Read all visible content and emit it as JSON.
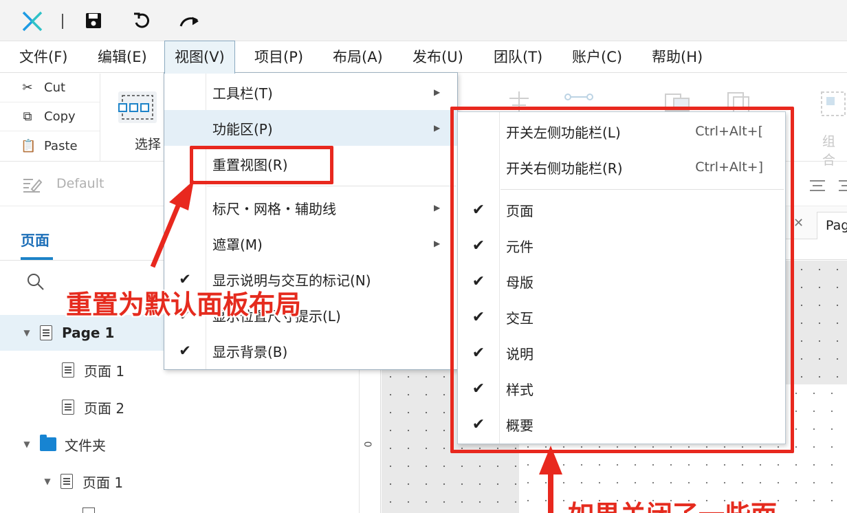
{
  "menubar": {
    "items": [
      {
        "label": "文件(F)"
      },
      {
        "label": "编辑(E)"
      },
      {
        "label": "视图(V)"
      },
      {
        "label": "项目(P)"
      },
      {
        "label": "布局(A)"
      },
      {
        "label": "发布(U)"
      },
      {
        "label": "团队(T)"
      },
      {
        "label": "账户(C)"
      },
      {
        "label": "帮助(H)"
      }
    ]
  },
  "clipboard": {
    "cut": "Cut",
    "copy": "Copy",
    "paste": "Paste"
  },
  "ribbon": {
    "select_label": "选择",
    "group_label": "组合"
  },
  "stylebar": {
    "style_name": "Default"
  },
  "pages_panel": {
    "tab_label": "页面",
    "tree": [
      {
        "label": "Page 1"
      },
      {
        "label": "页面 1"
      },
      {
        "label": "页面 2"
      },
      {
        "label": "文件夹"
      },
      {
        "label": "页面 1"
      }
    ]
  },
  "canvas": {
    "tab_label": "Pag",
    "ruler_zero": "0"
  },
  "view_menu": {
    "items": [
      {
        "label": "工具栏(T)"
      },
      {
        "label": "功能区(P)"
      },
      {
        "label": "重置视图(R)"
      },
      {
        "label": "标尺・网格・辅助线"
      },
      {
        "label": "遮罩(M)"
      },
      {
        "label": "显示说明与交互的标记(N)",
        "checked": true
      },
      {
        "label": "显示位置尺寸提示(L)",
        "checked": true
      },
      {
        "label": "显示背景(B)",
        "checked": true
      }
    ]
  },
  "ribbon_submenu": {
    "items": [
      {
        "label": "开关左侧功能栏(L)",
        "shortcut": "Ctrl+Alt+["
      },
      {
        "label": "开关右侧功能栏(R)",
        "shortcut": "Ctrl+Alt+]"
      },
      {
        "label": "页面",
        "checked": true
      },
      {
        "label": "元件",
        "checked": true
      },
      {
        "label": "母版",
        "checked": true
      },
      {
        "label": "交互",
        "checked": true
      },
      {
        "label": "说明",
        "checked": true
      },
      {
        "label": "样式",
        "checked": true
      },
      {
        "label": "概要",
        "checked": true
      }
    ]
  },
  "annotations": {
    "reset_note": "重置为默认面板布局",
    "bottom_note": "如果关闭了一些面"
  },
  "colors": {
    "accent": "#1d83c8",
    "annotation_red": "#e8281e",
    "folder": "#1784d2"
  }
}
